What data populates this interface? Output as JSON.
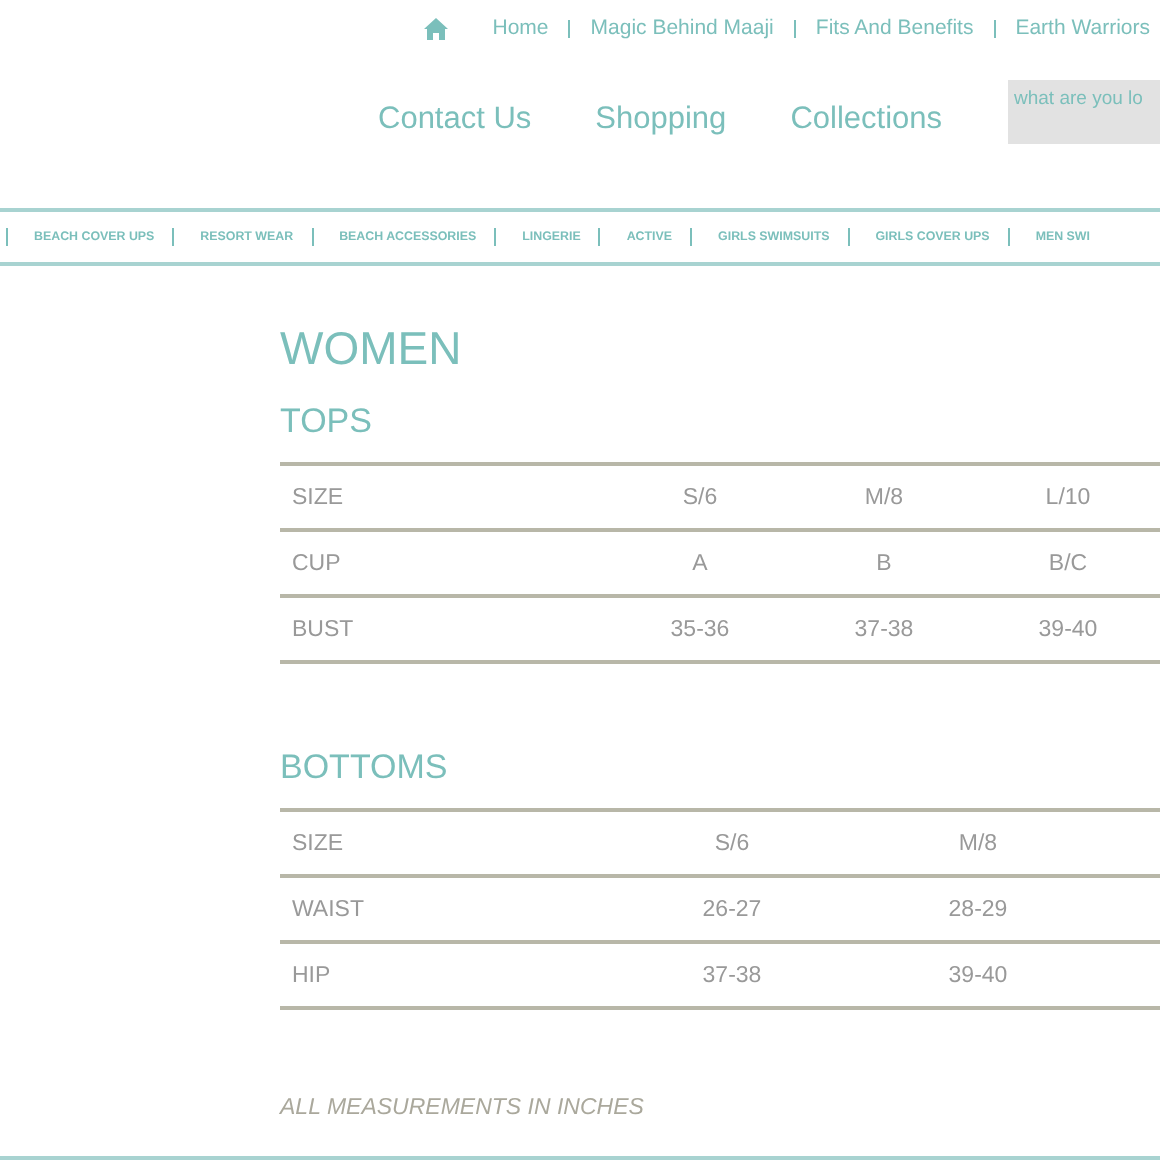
{
  "top_links": [
    {
      "label": "Home"
    },
    {
      "label": "Magic Behind Maaji"
    },
    {
      "label": "Fits And Benefits"
    },
    {
      "label": "Earth Warriors"
    }
  ],
  "main_nav": [
    {
      "label": "Contact Us"
    },
    {
      "label": "Shopping"
    },
    {
      "label": "Collections"
    }
  ],
  "search": {
    "placeholder": "what are you lo"
  },
  "categories": [
    {
      "label": "BEACH COVER UPS"
    },
    {
      "label": "RESORT WEAR"
    },
    {
      "label": "BEACH ACCESSORIES"
    },
    {
      "label": "LINGERIE"
    },
    {
      "label": "ACTIVE"
    },
    {
      "label": "GIRLS SWIMSUITS"
    },
    {
      "label": "GIRLS COVER UPS"
    },
    {
      "label": "MEN SWI"
    }
  ],
  "title": "WOMEN",
  "tables": [
    {
      "kind": "tops",
      "heading": "TOPS",
      "rows": [
        [
          "SIZE",
          "S/6",
          "M/8",
          "L/10"
        ],
        [
          "CUP",
          "A",
          "B",
          "B/C"
        ],
        [
          "BUST",
          "35-36",
          "37-38",
          "39-40"
        ]
      ]
    },
    {
      "kind": "bottoms",
      "heading": "BOTTOMS",
      "rows": [
        [
          "SIZE",
          "S/6",
          "M/8"
        ],
        [
          "WAIST",
          "26-27",
          "28-29"
        ],
        [
          "HIP",
          "37-38",
          "39-40"
        ]
      ]
    }
  ],
  "note": "ALL MEASUREMENTS IN INCHES"
}
